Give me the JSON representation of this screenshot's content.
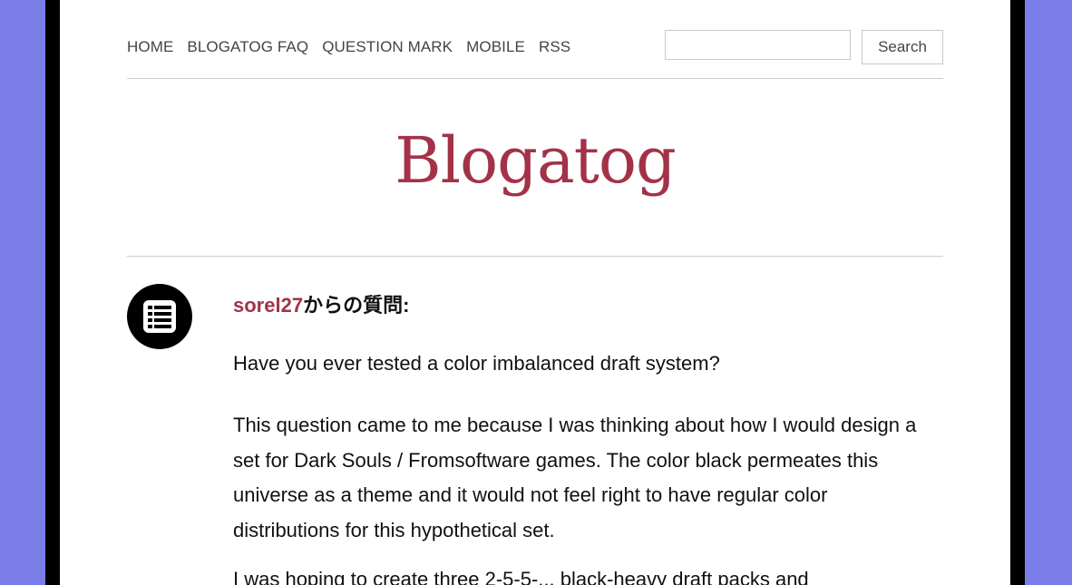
{
  "nav": {
    "items": [
      "HOME",
      "BLOGATOG FAQ",
      "QUESTION MARK",
      "MOBILE",
      "RSS"
    ]
  },
  "search": {
    "value": "",
    "placeholder": "",
    "button_label": "Search"
  },
  "site": {
    "title": "Blogatog"
  },
  "post": {
    "icon": "text-post-icon",
    "asker_name": "sorel27",
    "asker_suffix": "からの質問:",
    "paragraphs": [
      "Have you ever tested a color imbalanced draft system?",
      "This question came to me because I was thinking about how I would design a set for Dark Souls / Fromsoftware games. The color black permeates this universe as a theme and it would not feel right to have regular color distributions for this hypothetical set.",
      "I was hoping to create three 2-5-5-... black-heavy draft packs and"
    ]
  },
  "colors": {
    "background": "#7b7de8",
    "accent": "#a33248",
    "frame": "#000000"
  }
}
